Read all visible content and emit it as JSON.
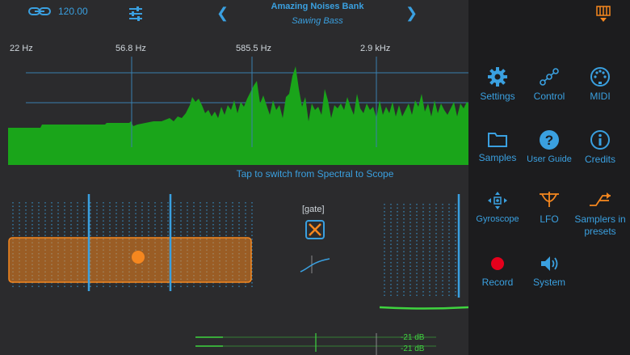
{
  "topbar": {
    "tempo": "120.00",
    "bank_title": "Amazing Noises Bank",
    "preset_name": "Sawing Bass"
  },
  "spectrum": {
    "freq_labels": [
      "22 Hz",
      "56.8 Hz",
      "585.5 Hz",
      "2.9 kHz"
    ],
    "hint": "Tap to switch from Spectral to Scope",
    "fill_color": "#1aa51a"
  },
  "controls": {
    "gate_label": "[gate]",
    "meter_left": "-21 dB",
    "meter_right": "-21 dB"
  },
  "menu": {
    "items": [
      {
        "label": "Settings",
        "icon": "gear-icon"
      },
      {
        "label": "Control",
        "icon": "nodes-icon"
      },
      {
        "label": "MIDI",
        "icon": "midi-icon"
      },
      {
        "label": "Samples",
        "icon": "folder-icon"
      },
      {
        "label": "User Guide",
        "icon": "question-icon"
      },
      {
        "label": "Credits",
        "icon": "info-icon"
      },
      {
        "label": "Gyroscope",
        "icon": "gyroscope-icon"
      },
      {
        "label": "LFO",
        "icon": "lfo-icon"
      },
      {
        "label": "Samplers in presets",
        "icon": "samplers-icon"
      },
      {
        "label": "Record",
        "icon": "record-icon"
      },
      {
        "label": "System",
        "icon": "speaker-icon"
      }
    ]
  },
  "colors": {
    "accent": "#3aa0e0",
    "orange": "#f5871f",
    "green": "#1aa51a",
    "record": "#e5001c"
  }
}
